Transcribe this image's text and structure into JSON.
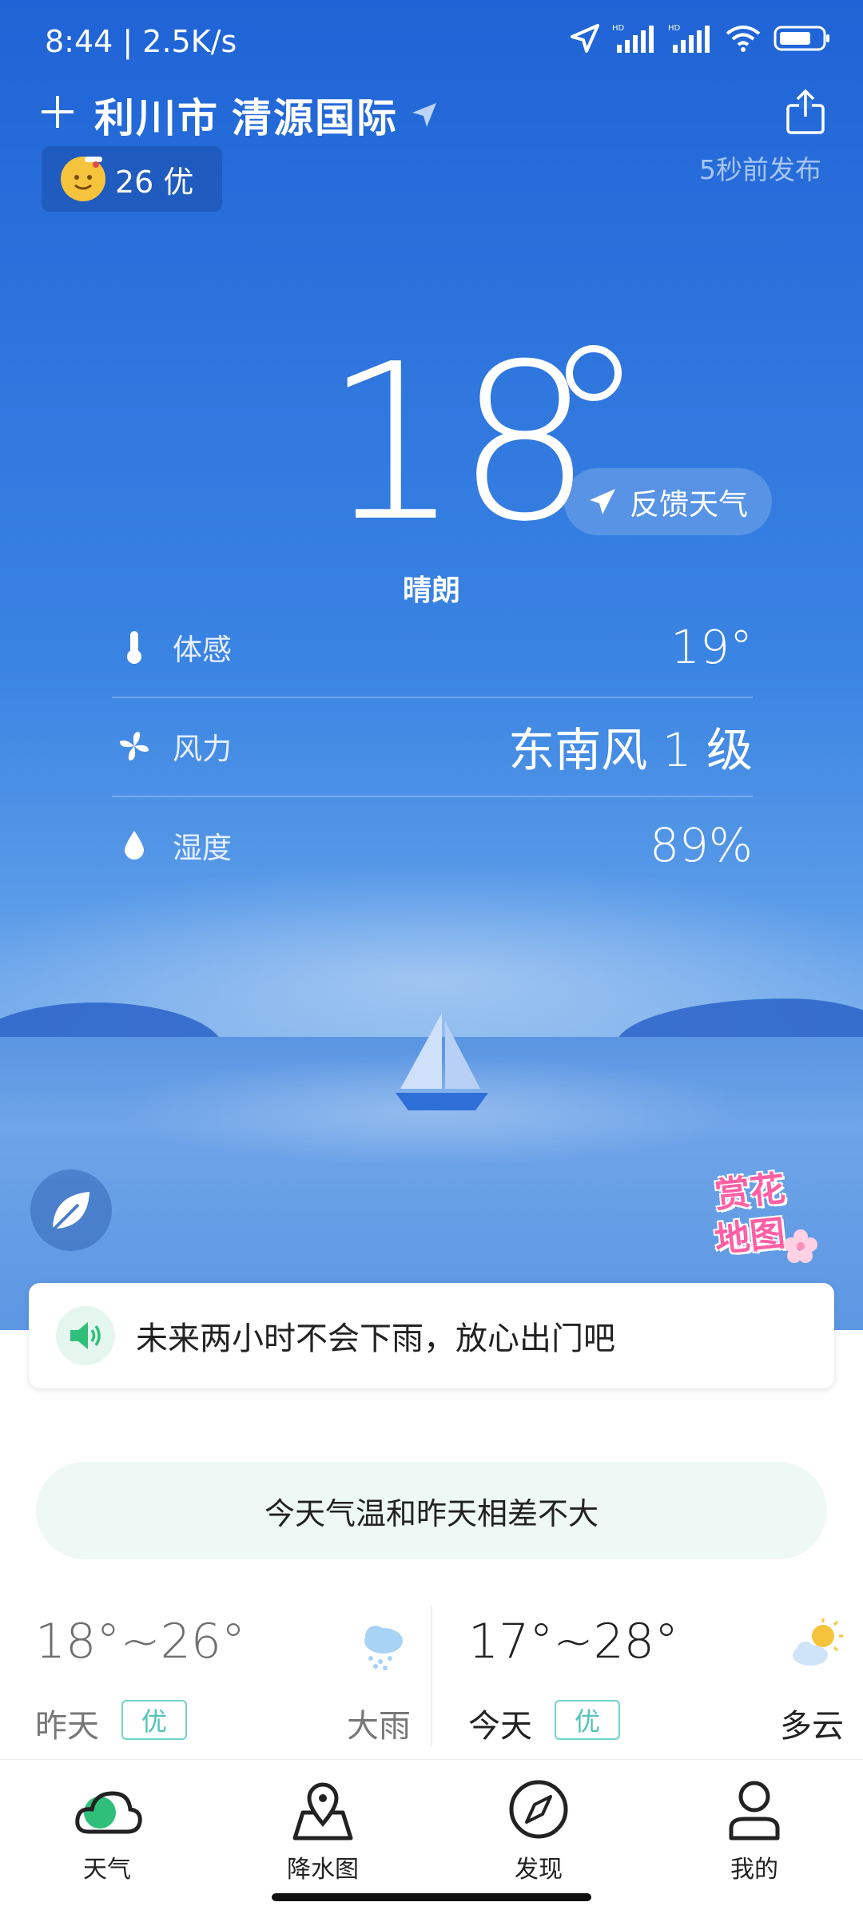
{
  "status_bar": {
    "time_speed": "8:44 | 2.5K/s",
    "icons": [
      "location-arrow-icon",
      "hd-signal-icon",
      "hd-signal-icon",
      "wifi-icon",
      "battery-icon"
    ]
  },
  "header": {
    "city": "利川市",
    "district": "清源国际",
    "publish_time": "5秒前发布"
  },
  "aqi": {
    "value_label": "26 优"
  },
  "current": {
    "temperature": "18",
    "condition": "晴朗",
    "feedback_label": "反馈天气"
  },
  "details": [
    {
      "label": "体感",
      "value": "19°",
      "icon": "thermometer-icon"
    },
    {
      "label": "风力",
      "value": "东南风 1 级",
      "icon": "fan-icon"
    },
    {
      "label": "湿度",
      "value": "89%",
      "icon": "droplet-icon"
    }
  ],
  "flower_map": {
    "line1": "赏花",
    "line2": "地图"
  },
  "rain_notice": {
    "text": "未来两小时不会下雨，放心出门吧"
  },
  "compare": {
    "text": "今天气温和昨天相差不大"
  },
  "days": [
    {
      "range": "18°~26°",
      "label": "昨天",
      "aqi": "优",
      "condition": "大雨",
      "icon": "heavy-rain-icon"
    },
    {
      "range": "17°~28°",
      "label": "今天",
      "aqi": "优",
      "condition": "多云",
      "icon": "partly-cloudy-icon"
    }
  ],
  "nav": [
    {
      "label": "天气",
      "icon": "weather-cloud-icon"
    },
    {
      "label": "降水图",
      "icon": "map-pin-icon"
    },
    {
      "label": "发现",
      "icon": "compass-icon"
    },
    {
      "label": "我的",
      "icon": "user-icon"
    }
  ],
  "colors": {
    "sky_top": "#1f63d6",
    "accent_green": "#2fbf7a",
    "aqi_tag": "#52c3b8"
  }
}
